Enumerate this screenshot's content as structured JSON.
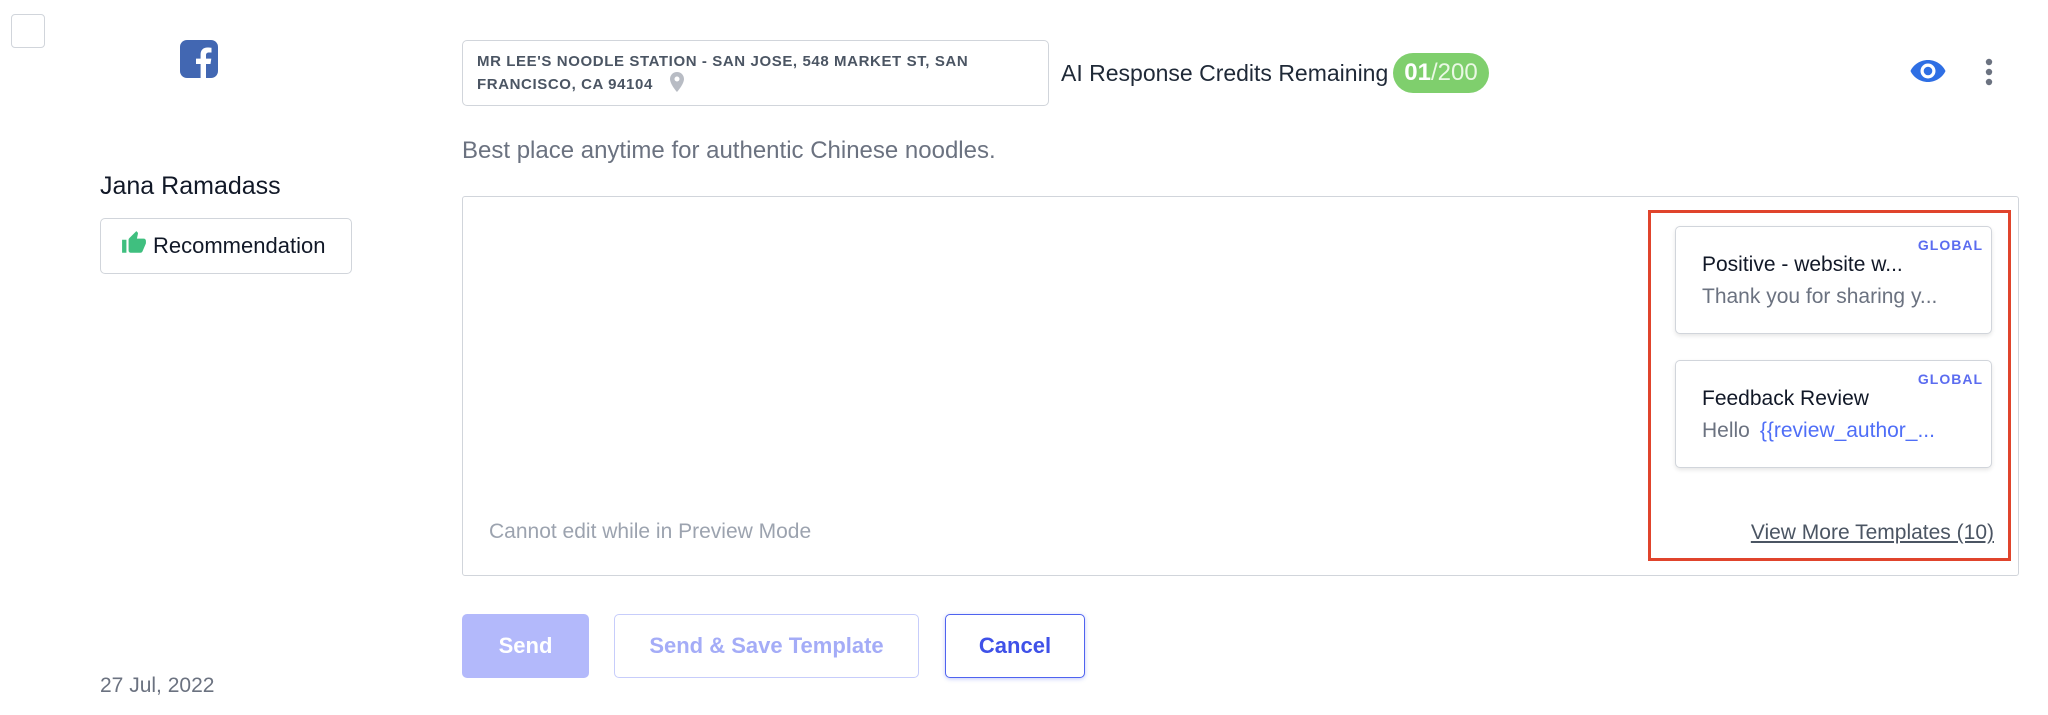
{
  "review": {
    "author": "Jana Ramadass",
    "recommendation_label": "Recommendation",
    "date": "27 Jul, 2022",
    "text": "Best place anytime for authentic Chinese noodles.",
    "source_icon": "facebook-icon"
  },
  "header": {
    "location_line1": "MR LEE'S NOODLE STATION - SAN JOSE, 548 MARKET ST, SAN",
    "location_line2": "FRANCISCO, CA 94104",
    "credits_label": "AI Response Credits Remaining",
    "credits_used": "01",
    "credits_total": "/200"
  },
  "editor": {
    "preview_note": "Cannot edit while in Preview Mode"
  },
  "templates": {
    "items": [
      {
        "scope": "GLOBAL",
        "title": "Positive - website w...",
        "body": "Thank you for sharing y...",
        "variable": ""
      },
      {
        "scope": "GLOBAL",
        "title": "Feedback Review",
        "body": "Hello",
        "variable": "{{review_author_..."
      }
    ],
    "view_more": "View More Templates (10)"
  },
  "actions": {
    "send": "Send",
    "send_save": "Send & Save Template",
    "cancel": "Cancel"
  },
  "colors": {
    "accent": "#4f63ef",
    "facebook": "#4267B2",
    "credits_badge": "#7fcf6d",
    "highlight_border": "#e0442c",
    "recommend_icon": "#3fbf7f"
  }
}
